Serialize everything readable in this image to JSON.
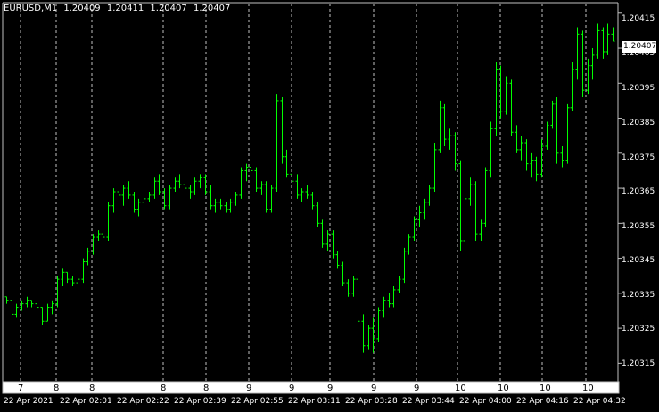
{
  "header": {
    "symbol": "EURUSD,M1",
    "open": "1.20409",
    "high": "1.20411",
    "low": "1.20407",
    "close": "1.20407"
  },
  "current_price_tag": "1.20407",
  "price_axis": [
    "1.20415",
    "1.20405",
    "1.20395",
    "1.20385",
    "1.20375",
    "1.20365",
    "1.20355",
    "1.20345",
    "1.20335",
    "1.20325",
    "1.20315"
  ],
  "time_axis": [
    "22 Apr 2021",
    "22 Apr 02:01",
    "22 Apr 02:22",
    "22 Apr 02:39",
    "22 Apr 02:55",
    "22 Apr 03:11",
    "22 Apr 03:28",
    "22 Apr 03:44",
    "22 Apr 04:00",
    "22 Apr 04:16",
    "22 Apr 04:32"
  ],
  "day_row": [
    "7",
    "8",
    "8",
    "8",
    "8",
    "9",
    "9",
    "9",
    "9",
    "9",
    "9",
    "10",
    "10",
    "10",
    "10"
  ],
  "corner_mark": "#",
  "colors": {
    "background": "#000000",
    "candle": "#00ff00",
    "grid": "#c0c0c0",
    "text": "#ffffff"
  },
  "chart_data": {
    "type": "bar",
    "symbol": "EURUSD",
    "timeframe": "M1",
    "ylim": [
      1.2031,
      1.20418
    ],
    "grid": true,
    "series": [
      {
        "values": [
          [
            1.20334,
            1.20334,
            1.20332,
            1.20333
          ],
          [
            1.20333,
            1.20333,
            1.20328,
            1.20329
          ],
          [
            1.20329,
            1.20332,
            1.20328,
            1.20331
          ],
          [
            1.20331,
            1.20333,
            1.2033,
            1.20332
          ],
          [
            1.20332,
            1.20334,
            1.20331,
            1.20333
          ],
          [
            1.20333,
            1.20333,
            1.20331,
            1.20332
          ],
          [
            1.20332,
            1.20333,
            1.2033,
            1.20331
          ],
          [
            1.20331,
            1.20331,
            1.20326,
            1.20327
          ],
          [
            1.20327,
            1.20332,
            1.20327,
            1.20331
          ],
          [
            1.20331,
            1.20333,
            1.20329,
            1.20332
          ],
          [
            1.20332,
            1.2034,
            1.20331,
            1.20339
          ],
          [
            1.20339,
            1.20342,
            1.20337,
            1.20341
          ],
          [
            1.20341,
            1.20341,
            1.20338,
            1.20339
          ],
          [
            1.20339,
            1.2034,
            1.20337,
            1.20338
          ],
          [
            1.20338,
            1.2034,
            1.20337,
            1.20339
          ],
          [
            1.20339,
            1.20345,
            1.20338,
            1.20344
          ],
          [
            1.20344,
            1.20348,
            1.20343,
            1.20347
          ],
          [
            1.20347,
            1.20352,
            1.20346,
            1.20351
          ],
          [
            1.20351,
            1.20353,
            1.2035,
            1.20352
          ],
          [
            1.20352,
            1.20353,
            1.2035,
            1.20351
          ],
          [
            1.20351,
            1.20361,
            1.2035,
            1.2036
          ],
          [
            1.2036,
            1.20365,
            1.20358,
            1.20364
          ],
          [
            1.20364,
            1.20367,
            1.20361,
            1.20363
          ],
          [
            1.20363,
            1.20366,
            1.2036,
            1.20365
          ],
          [
            1.20365,
            1.20367,
            1.20362,
            1.20363
          ],
          [
            1.20363,
            1.20364,
            1.20358,
            1.20359
          ],
          [
            1.20359,
            1.20362,
            1.20357,
            1.20361
          ],
          [
            1.20361,
            1.20364,
            1.2036,
            1.20362
          ],
          [
            1.20362,
            1.20364,
            1.20361,
            1.20363
          ],
          [
            1.20363,
            1.20368,
            1.20362,
            1.20367
          ],
          [
            1.20367,
            1.20369,
            1.20363,
            1.20364
          ],
          [
            1.20364,
            1.20365,
            1.20359,
            1.2036
          ],
          [
            1.2036,
            1.20366,
            1.20359,
            1.20365
          ],
          [
            1.20365,
            1.20368,
            1.20364,
            1.20367
          ],
          [
            1.20367,
            1.20369,
            1.20365,
            1.20366
          ],
          [
            1.20366,
            1.20368,
            1.20364,
            1.20365
          ],
          [
            1.20365,
            1.20366,
            1.20362,
            1.20364
          ],
          [
            1.20364,
            1.20368,
            1.20363,
            1.20367
          ],
          [
            1.20367,
            1.20369,
            1.20365,
            1.20368
          ],
          [
            1.20368,
            1.20369,
            1.20363,
            1.20364
          ],
          [
            1.20364,
            1.20366,
            1.20359,
            1.2036
          ],
          [
            1.2036,
            1.20362,
            1.20358,
            1.20361
          ],
          [
            1.20361,
            1.20362,
            1.20359,
            1.2036
          ],
          [
            1.2036,
            1.20361,
            1.20358,
            1.20359
          ],
          [
            1.20359,
            1.20362,
            1.20358,
            1.20361
          ],
          [
            1.20361,
            1.20364,
            1.2036,
            1.20363
          ],
          [
            1.20363,
            1.20371,
            1.20362,
            1.2037
          ],
          [
            1.2037,
            1.20372,
            1.20367,
            1.20371
          ],
          [
            1.20371,
            1.20372,
            1.20369,
            1.2037
          ],
          [
            1.2037,
            1.20371,
            1.20364,
            1.20365
          ],
          [
            1.20365,
            1.20367,
            1.20363,
            1.20366
          ],
          [
            1.20366,
            1.20367,
            1.20358,
            1.20359
          ],
          [
            1.20359,
            1.20366,
            1.20358,
            1.20365
          ],
          [
            1.20365,
            1.20392,
            1.20364,
            1.2039
          ],
          [
            1.2039,
            1.20391,
            1.20372,
            1.20374
          ],
          [
            1.20374,
            1.20376,
            1.20368,
            1.20369
          ],
          [
            1.20369,
            1.20372,
            1.20366,
            1.20367
          ],
          [
            1.20367,
            1.20369,
            1.20362,
            1.20363
          ],
          [
            1.20363,
            1.20365,
            1.20361,
            1.20364
          ],
          [
            1.20364,
            1.20366,
            1.20362,
            1.20363
          ],
          [
            1.20363,
            1.20364,
            1.20359,
            1.2036
          ],
          [
            1.2036,
            1.20361,
            1.20354,
            1.20355
          ],
          [
            1.20355,
            1.20356,
            1.20348,
            1.20349
          ],
          [
            1.20349,
            1.20353,
            1.20347,
            1.20352
          ],
          [
            1.20352,
            1.20353,
            1.20345,
            1.20346
          ],
          [
            1.20346,
            1.20347,
            1.20342,
            1.20343
          ],
          [
            1.20343,
            1.20344,
            1.20337,
            1.20338
          ],
          [
            1.20338,
            1.20339,
            1.20334,
            1.20335
          ],
          [
            1.20335,
            1.2034,
            1.20334,
            1.20339
          ],
          [
            1.20339,
            1.2034,
            1.20326,
            1.20327
          ],
          [
            1.20327,
            1.20329,
            1.20318,
            1.2032
          ],
          [
            1.2032,
            1.20326,
            1.20319,
            1.20325
          ],
          [
            1.20325,
            1.20328,
            1.20318,
            1.20322
          ],
          [
            1.20322,
            1.20331,
            1.20321,
            1.2033
          ],
          [
            1.2033,
            1.20334,
            1.20328,
            1.20333
          ],
          [
            1.20333,
            1.20335,
            1.20331,
            1.20332
          ],
          [
            1.20332,
            1.20337,
            1.20331,
            1.20336
          ],
          [
            1.20336,
            1.2034,
            1.20335,
            1.20339
          ],
          [
            1.20339,
            1.20348,
            1.20338,
            1.20347
          ],
          [
            1.20347,
            1.20352,
            1.20346,
            1.20351
          ],
          [
            1.20351,
            1.20357,
            1.2035,
            1.20356
          ],
          [
            1.20356,
            1.2036,
            1.20354,
            1.20358
          ],
          [
            1.20358,
            1.20362,
            1.20356,
            1.20361
          ],
          [
            1.20361,
            1.20366,
            1.2036,
            1.20365
          ],
          [
            1.20365,
            1.20378,
            1.20364,
            1.20376
          ],
          [
            1.20376,
            1.2039,
            1.20375,
            1.20388
          ],
          [
            1.20388,
            1.20389,
            1.20377,
            1.20379
          ],
          [
            1.20379,
            1.20382,
            1.20376,
            1.2038
          ],
          [
            1.2038,
            1.20381,
            1.2037,
            1.20372
          ],
          [
            1.20372,
            1.20373,
            1.20347,
            1.2035
          ],
          [
            1.2035,
            1.20364,
            1.20348,
            1.20362
          ],
          [
            1.20362,
            1.20368,
            1.2036,
            1.20366
          ],
          [
            1.20366,
            1.20367,
            1.2035,
            1.20352
          ],
          [
            1.20352,
            1.20356,
            1.2035,
            1.20355
          ],
          [
            1.20355,
            1.20371,
            1.20354,
            1.2037
          ],
          [
            1.2037,
            1.20384,
            1.20368,
            1.20382
          ],
          [
            1.20382,
            1.20401,
            1.2038,
            1.20399
          ],
          [
            1.20399,
            1.204,
            1.20385,
            1.20387
          ],
          [
            1.20387,
            1.20397,
            1.20386,
            1.20395
          ],
          [
            1.20395,
            1.20396,
            1.2038,
            1.20381
          ],
          [
            1.20381,
            1.20383,
            1.20375,
            1.20376
          ],
          [
            1.20376,
            1.2038,
            1.20373,
            1.20378
          ],
          [
            1.20378,
            1.20379,
            1.2037,
            1.20372
          ],
          [
            1.20372,
            1.20375,
            1.20368,
            1.20373
          ],
          [
            1.20373,
            1.20374,
            1.20367,
            1.20369
          ],
          [
            1.20369,
            1.20379,
            1.20368,
            1.20377
          ],
          [
            1.20377,
            1.20384,
            1.20376,
            1.20383
          ],
          [
            1.20383,
            1.2039,
            1.20382,
            1.20389
          ],
          [
            1.20389,
            1.20391,
            1.20372,
            1.20375
          ],
          [
            1.20375,
            1.20377,
            1.20371,
            1.20373
          ],
          [
            1.20373,
            1.20389,
            1.20372,
            1.20388
          ],
          [
            1.20388,
            1.20401,
            1.20387,
            1.20399
          ],
          [
            1.20399,
            1.20411,
            1.20396,
            1.20409
          ],
          [
            1.20409,
            1.2041,
            1.20391,
            1.20393
          ],
          [
            1.20393,
            1.20402,
            1.20392,
            1.204
          ],
          [
            1.204,
            1.20405,
            1.20396,
            1.20403
          ],
          [
            1.20403,
            1.20412,
            1.20402,
            1.2041
          ],
          [
            1.2041,
            1.20411,
            1.20402,
            1.20404
          ],
          [
            1.20404,
            1.20412,
            1.20403,
            1.20409
          ],
          [
            1.20409,
            1.20411,
            1.20407,
            1.20407
          ]
        ]
      }
    ]
  }
}
